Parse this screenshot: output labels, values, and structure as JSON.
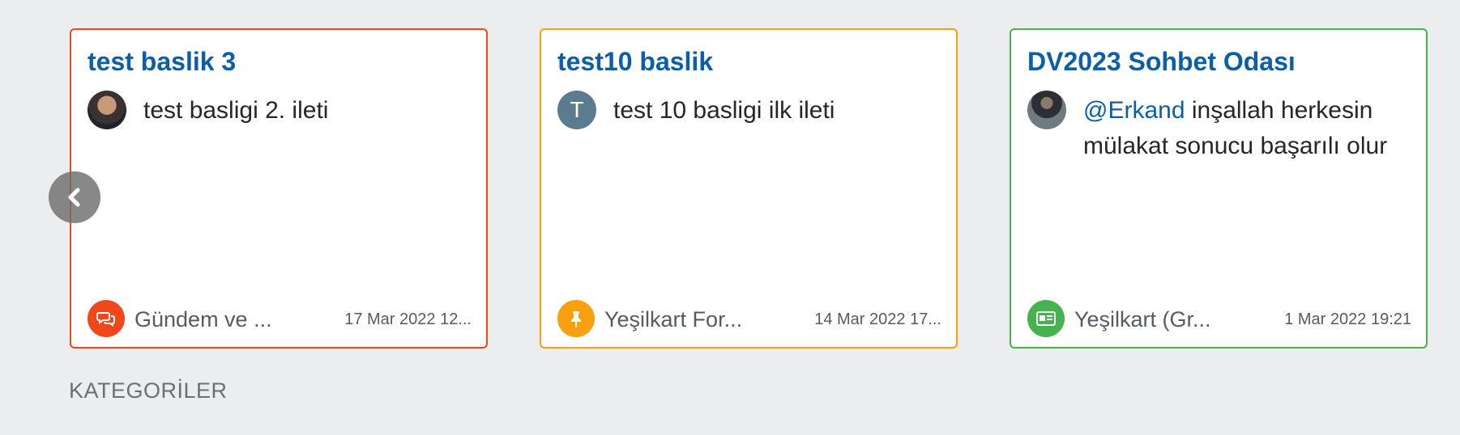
{
  "cards": [
    {
      "title": "test baslik 3",
      "text": "test basligi 2. ileti",
      "category": "Gündem ve ...",
      "timestamp": "17 Mar 2022 12...",
      "avatar_type": "photo",
      "category_icon": "chat-bubbles-icon",
      "accent_color": "#f0481b"
    },
    {
      "title": "test10 baslik",
      "text": "test 10 basligi ilk ileti",
      "avatar_letter": "T",
      "category": "Yeşilkart For...",
      "timestamp": "14 Mar 2022 17...",
      "avatar_type": "letter",
      "category_icon": "thumbtack-icon",
      "accent_color": "#f8a00f"
    },
    {
      "title": "DV2023 Sohbet Odası",
      "mention": "@Erkand",
      "text": " inşallah herkesin mülakat sonucu başarılı olur",
      "category": "Yeşilkart (Gr...",
      "timestamp": "1 Mar 2022 19:21",
      "avatar_type": "photo",
      "category_icon": "id-card-icon",
      "accent_color": "#46b250"
    }
  ],
  "carousel": {
    "prev_icon": "chevron-left-icon"
  },
  "categories_heading": "KATEGORİLER",
  "colors": {
    "link": "#0b5ea8",
    "page_background": "#ebedef",
    "avatar_letter_bg": "#5b7b8f"
  }
}
